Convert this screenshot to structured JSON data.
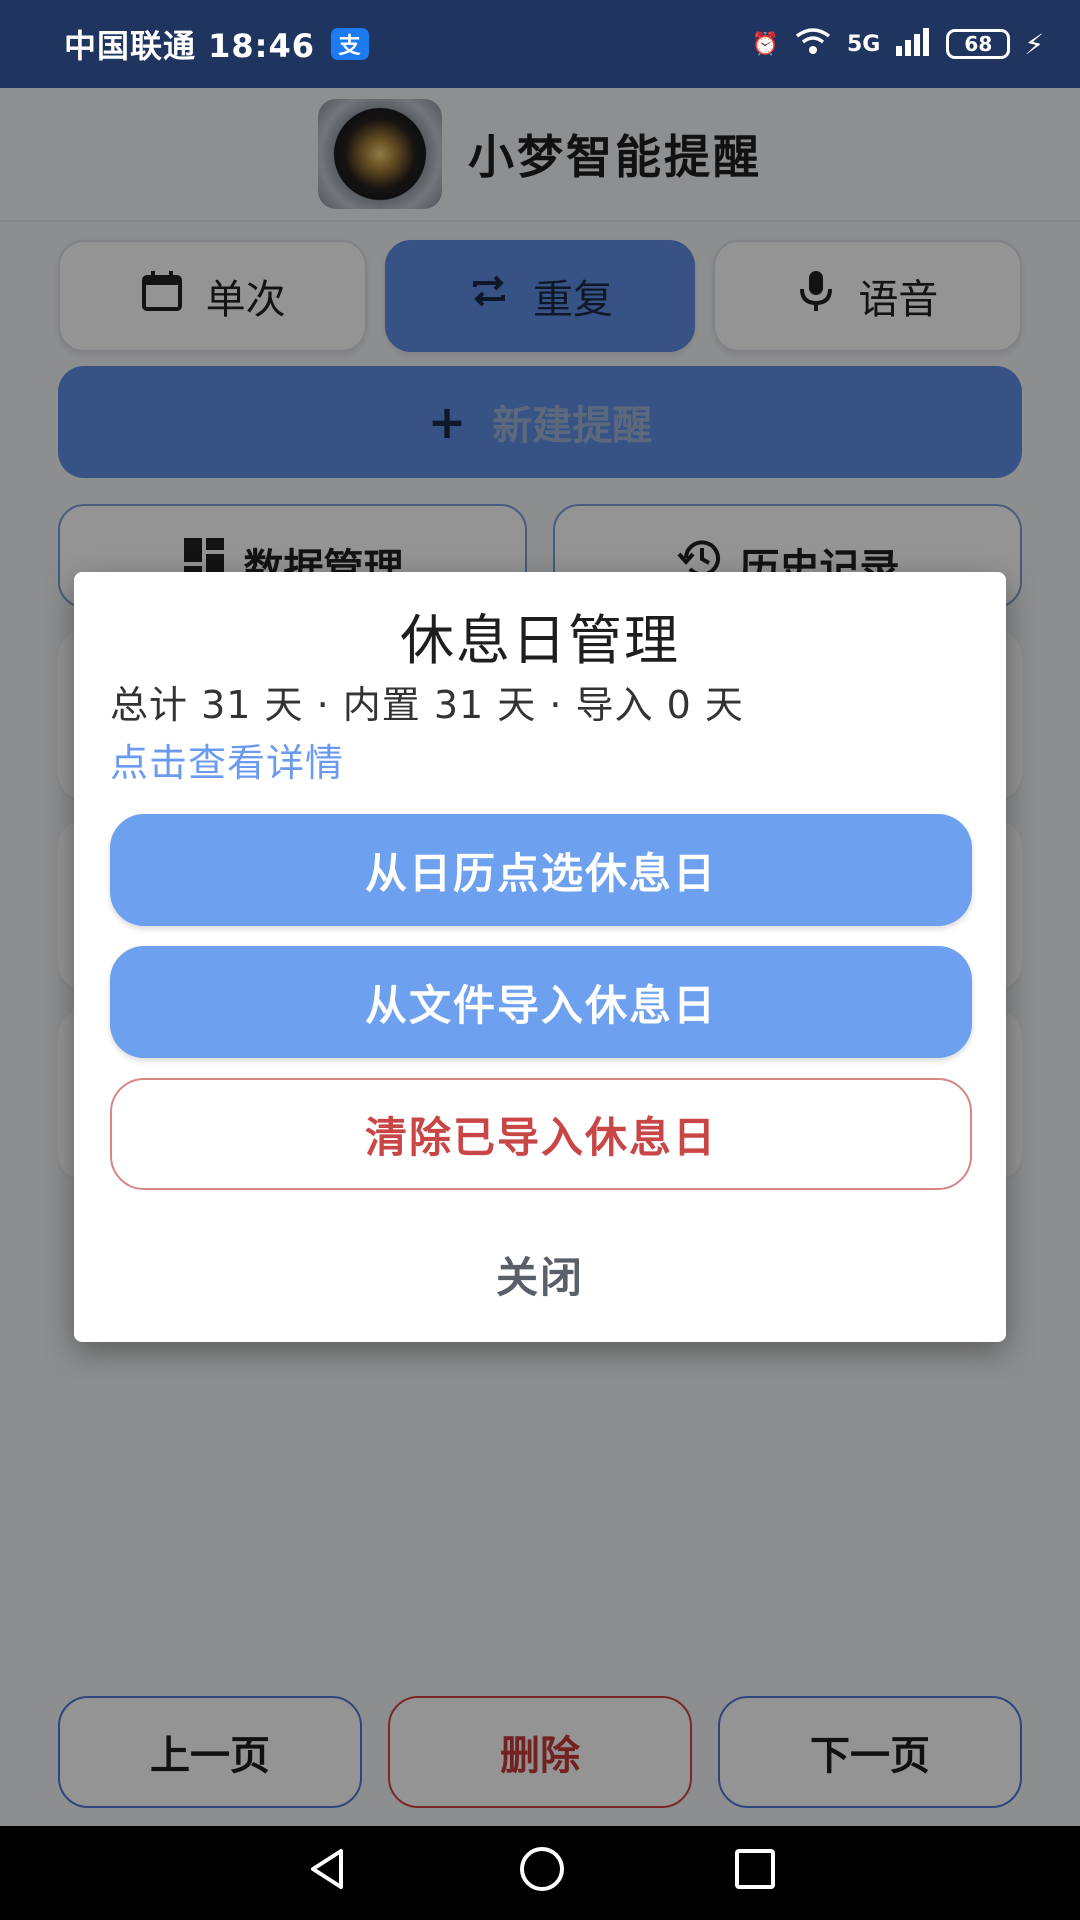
{
  "status_bar": {
    "carrier_time": "中国联通 18:46",
    "alipay_badge": "支",
    "network_label": "5G",
    "battery_level": "68",
    "icons": [
      "alarm-icon",
      "wifi-icon",
      "signal-icon",
      "battery-icon",
      "charging-icon"
    ]
  },
  "header": {
    "title": "小梦智能提醒",
    "logo_icon": "alarm-clock-logo"
  },
  "mode_tabs": [
    {
      "label": "单次",
      "icon": "calendar-icon",
      "active": false
    },
    {
      "label": "重复",
      "icon": "repeat-icon",
      "active": true
    },
    {
      "label": "语音",
      "icon": "microphone-icon",
      "active": false
    }
  ],
  "new_reminder": {
    "label": "新建提醒",
    "icon": "plus-icon"
  },
  "sub_buttons": [
    {
      "label": "数据管理",
      "icon": "grid-icon"
    },
    {
      "label": "历史记录",
      "icon": "history-icon"
    }
  ],
  "bottom_nav": {
    "prev": "上一页",
    "delete": "删除",
    "next": "下一页"
  },
  "dialog": {
    "title": "休息日管理",
    "stats": "总计 31 天 · 内置 31 天 · 导入 0 天",
    "details_link": "点击查看详情",
    "pick_from_calendar": "从日历点选休息日",
    "import_from_file": "从文件导入休息日",
    "clear_imported": "清除已导入休息日",
    "close": "关闭"
  },
  "colors": {
    "status_bar": "#1f3560",
    "accent": "#5f8fe6",
    "dialog_primary": "#6da0ef",
    "danger": "#c94646",
    "link": "#6b9bf0"
  }
}
